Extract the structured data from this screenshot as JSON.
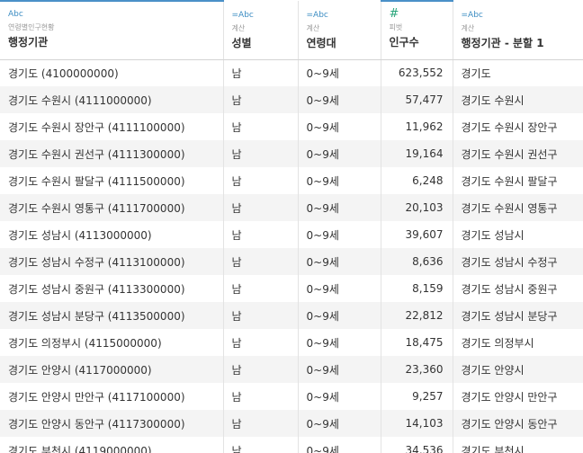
{
  "columns": [
    {
      "type_icon": "Abc",
      "caption": "연령별인구현황",
      "name": "행정기관"
    },
    {
      "type_icon": "=Abc",
      "caption": "계산",
      "name": "성별"
    },
    {
      "type_icon": "=Abc",
      "caption": "계산",
      "name": "연령대"
    },
    {
      "type_icon": "#",
      "caption": "피벗",
      "name": "인구수"
    },
    {
      "type_icon": "=Abc",
      "caption": "계산",
      "name": "행정기관 - 분할 1"
    }
  ],
  "rows": [
    {
      "agency": "경기도  (4100000000)",
      "sex": "남",
      "age_group": "0~9세",
      "population": "623,552",
      "split1": "경기도"
    },
    {
      "agency": "경기도 수원시 (4111000000)",
      "sex": "남",
      "age_group": "0~9세",
      "population": "57,477",
      "split1": "경기도 수원시"
    },
    {
      "agency": "경기도 수원시 장안구 (4111100000)",
      "sex": "남",
      "age_group": "0~9세",
      "population": "11,962",
      "split1": "경기도 수원시 장안구"
    },
    {
      "agency": "경기도 수원시 권선구 (4111300000)",
      "sex": "남",
      "age_group": "0~9세",
      "population": "19,164",
      "split1": "경기도 수원시 권선구"
    },
    {
      "agency": "경기도 수원시 팔달구 (4111500000)",
      "sex": "남",
      "age_group": "0~9세",
      "population": "6,248",
      "split1": "경기도 수원시 팔달구"
    },
    {
      "agency": "경기도 수원시 영통구 (4111700000)",
      "sex": "남",
      "age_group": "0~9세",
      "population": "20,103",
      "split1": "경기도 수원시 영통구"
    },
    {
      "agency": "경기도 성남시 (4113000000)",
      "sex": "남",
      "age_group": "0~9세",
      "population": "39,607",
      "split1": "경기도 성남시"
    },
    {
      "agency": "경기도 성남시 수정구 (4113100000)",
      "sex": "남",
      "age_group": "0~9세",
      "population": "8,636",
      "split1": "경기도 성남시 수정구"
    },
    {
      "agency": "경기도 성남시 중원구 (4113300000)",
      "sex": "남",
      "age_group": "0~9세",
      "population": "8,159",
      "split1": "경기도 성남시 중원구"
    },
    {
      "agency": "경기도 성남시 분당구 (4113500000)",
      "sex": "남",
      "age_group": "0~9세",
      "population": "22,812",
      "split1": "경기도 성남시 분당구"
    },
    {
      "agency": "경기도 의정부시 (4115000000)",
      "sex": "남",
      "age_group": "0~9세",
      "population": "18,475",
      "split1": "경기도 의정부시"
    },
    {
      "agency": "경기도 안양시 (4117000000)",
      "sex": "남",
      "age_group": "0~9세",
      "population": "23,360",
      "split1": "경기도 안양시"
    },
    {
      "agency": "경기도 안양시 만안구 (4117100000)",
      "sex": "남",
      "age_group": "0~9세",
      "population": "9,257",
      "split1": "경기도 안양시 만안구"
    },
    {
      "agency": "경기도 안양시 동안구 (4117300000)",
      "sex": "남",
      "age_group": "0~9세",
      "population": "14,103",
      "split1": "경기도 안양시 동안구"
    },
    {
      "agency": "경기도 부천시 (4119000000)",
      "sex": "남",
      "age_group": "0~9세",
      "population": "34,536",
      "split1": "경기도 부천시"
    }
  ]
}
